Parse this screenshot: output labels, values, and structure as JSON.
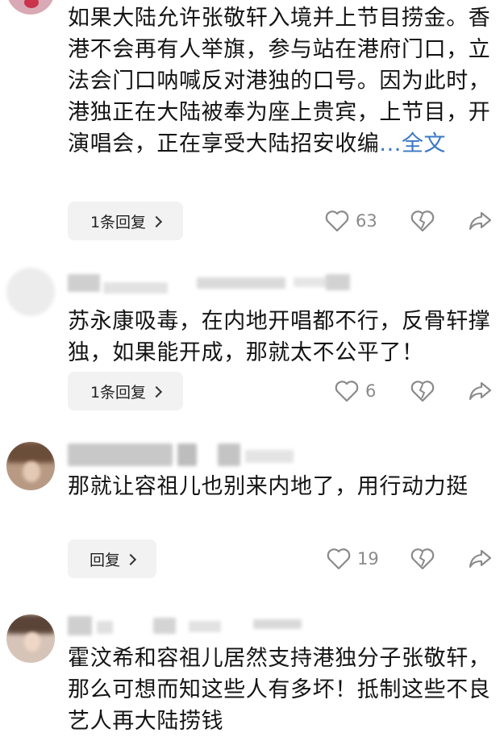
{
  "comments": [
    {
      "body": "如果大陆允许张敬轩入境并上节目捞金。香港不会再有人举旗，参与站在港府门口，立法会门口呐喊反对港独的口号。因为此时，港独正在大陆被奉为座上贵宾，上节目，开演唱会，正在享受大陆招安收编",
      "more_label": "...全文",
      "reply_label": "1条回复",
      "likes": "63"
    },
    {
      "body": "苏永康吸毒，在内地开唱都不行，反骨轩撑独，如果能开成，那就太不公平了！",
      "reply_label": "1条回复",
      "likes": "6"
    },
    {
      "body": "那就让容祖儿也别来内地了，用行动力挺",
      "reply_label": "回复",
      "likes": "19"
    },
    {
      "body": "霍汶希和容祖儿居然支持港独分子张敬轩，那么可想而知这些人有多坏！抵制这些不良艺人再大陆捞钱"
    }
  ],
  "icons": {
    "like": "heart-outline-icon",
    "dislike": "broken-heart-icon",
    "share": "share-arrow-icon"
  },
  "colors": {
    "link": "#3a78c5",
    "reply_bg": "#f2f2f2",
    "icon": "#8a8a8a"
  }
}
